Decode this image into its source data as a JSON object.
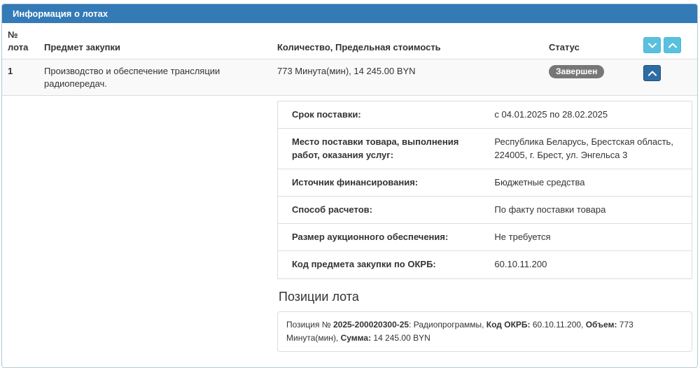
{
  "panel": {
    "title": "Информация о лотах"
  },
  "table": {
    "headers": {
      "lot_number": "№ лота",
      "subject": "Предмет закупки",
      "quantity": "Количество, Предельная стоимость",
      "status": "Статус"
    }
  },
  "lot": {
    "number": "1",
    "subject": "Производство и обеспечение трансляции радиопередач.",
    "quantity": "773 Минута(мин), 14 245.00 BYN",
    "status": "Завершен"
  },
  "details": {
    "rows": [
      {
        "label": "Срок поставки:",
        "value": "с 04.01.2025 по 28.02.2025"
      },
      {
        "label": "Место поставки товара, выполнения работ, оказания услуг:",
        "value": "Республика Беларусь, Брестская область, 224005, г. Брест, ул. Энгельса 3"
      },
      {
        "label": "Источник финансирования:",
        "value": "Бюджетные средства"
      },
      {
        "label": "Способ расчетов:",
        "value": "По факту поставки товара"
      },
      {
        "label": "Размер аукционного обеспечения:",
        "value": "Не требуется"
      },
      {
        "label": "Код предмета закупки по ОКРБ:",
        "value": "60.10.11.200"
      }
    ]
  },
  "positions": {
    "heading": "Позиции лота",
    "item": {
      "prefix": "Позиция № ",
      "number": "2025-200020300-25",
      "name_part": ": Радиопрограммы, ",
      "okrb_label": "Код ОКРБ:",
      "okrb_value": " 60.10.11.200, ",
      "volume_label": "Объем:",
      "volume_value": " 773 Минута(мин), ",
      "sum_label": "Сумма:",
      "sum_value": " 14 245.00 BYN"
    }
  },
  "icons": {
    "header_expand": "chevron-down-icon",
    "header_collapse": "chevron-up-icon",
    "lot_collapse": "chevron-up-icon"
  },
  "colors": {
    "header_bg": "#337ab7",
    "panel_border": "#b3c9d6",
    "info_button_bg": "#5bc0de",
    "lot_button_bg": "#2e6da4",
    "badge_bg": "#777777",
    "row_bg": "#f9f9f9",
    "divider": "#dddddd",
    "text": "#333333"
  }
}
